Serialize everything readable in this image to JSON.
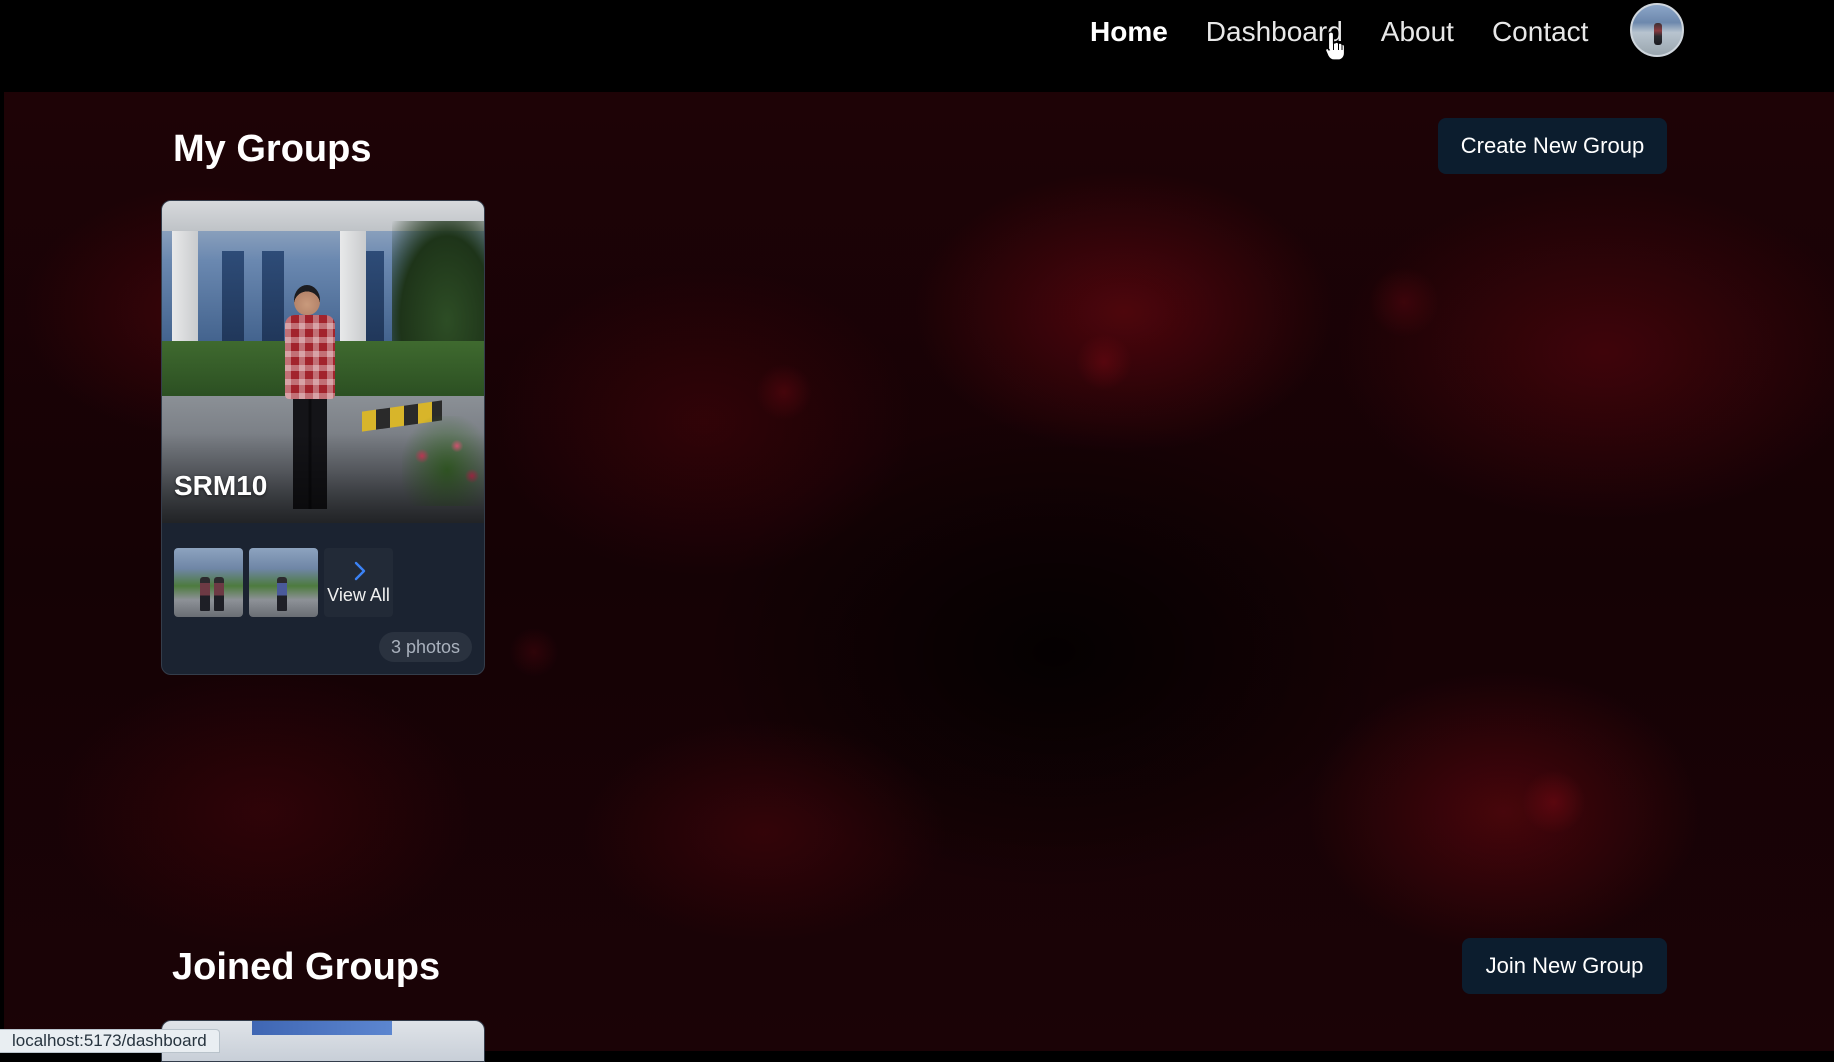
{
  "nav": {
    "links": [
      "Home",
      "Dashboard",
      "About",
      "Contact"
    ],
    "active": "Home"
  },
  "my_groups": {
    "title": "My Groups",
    "create_button": "Create New Group",
    "groups": [
      {
        "name": "SRM10",
        "view_all_label": "View All",
        "photo_count": "3 photos"
      }
    ]
  },
  "joined_groups": {
    "title": "Joined Groups",
    "join_button": "Join New Group"
  },
  "status_bar": {
    "url": "localhost:5173/dashboard"
  },
  "icons": {
    "view_all": "chevron-right-icon",
    "cursor": "hand-pointer-icon"
  },
  "colors": {
    "button_bg": "#0c1d2e",
    "card_bg": "#1b2331",
    "chevron": "#3b82f6",
    "background_red": "#1e0306"
  }
}
